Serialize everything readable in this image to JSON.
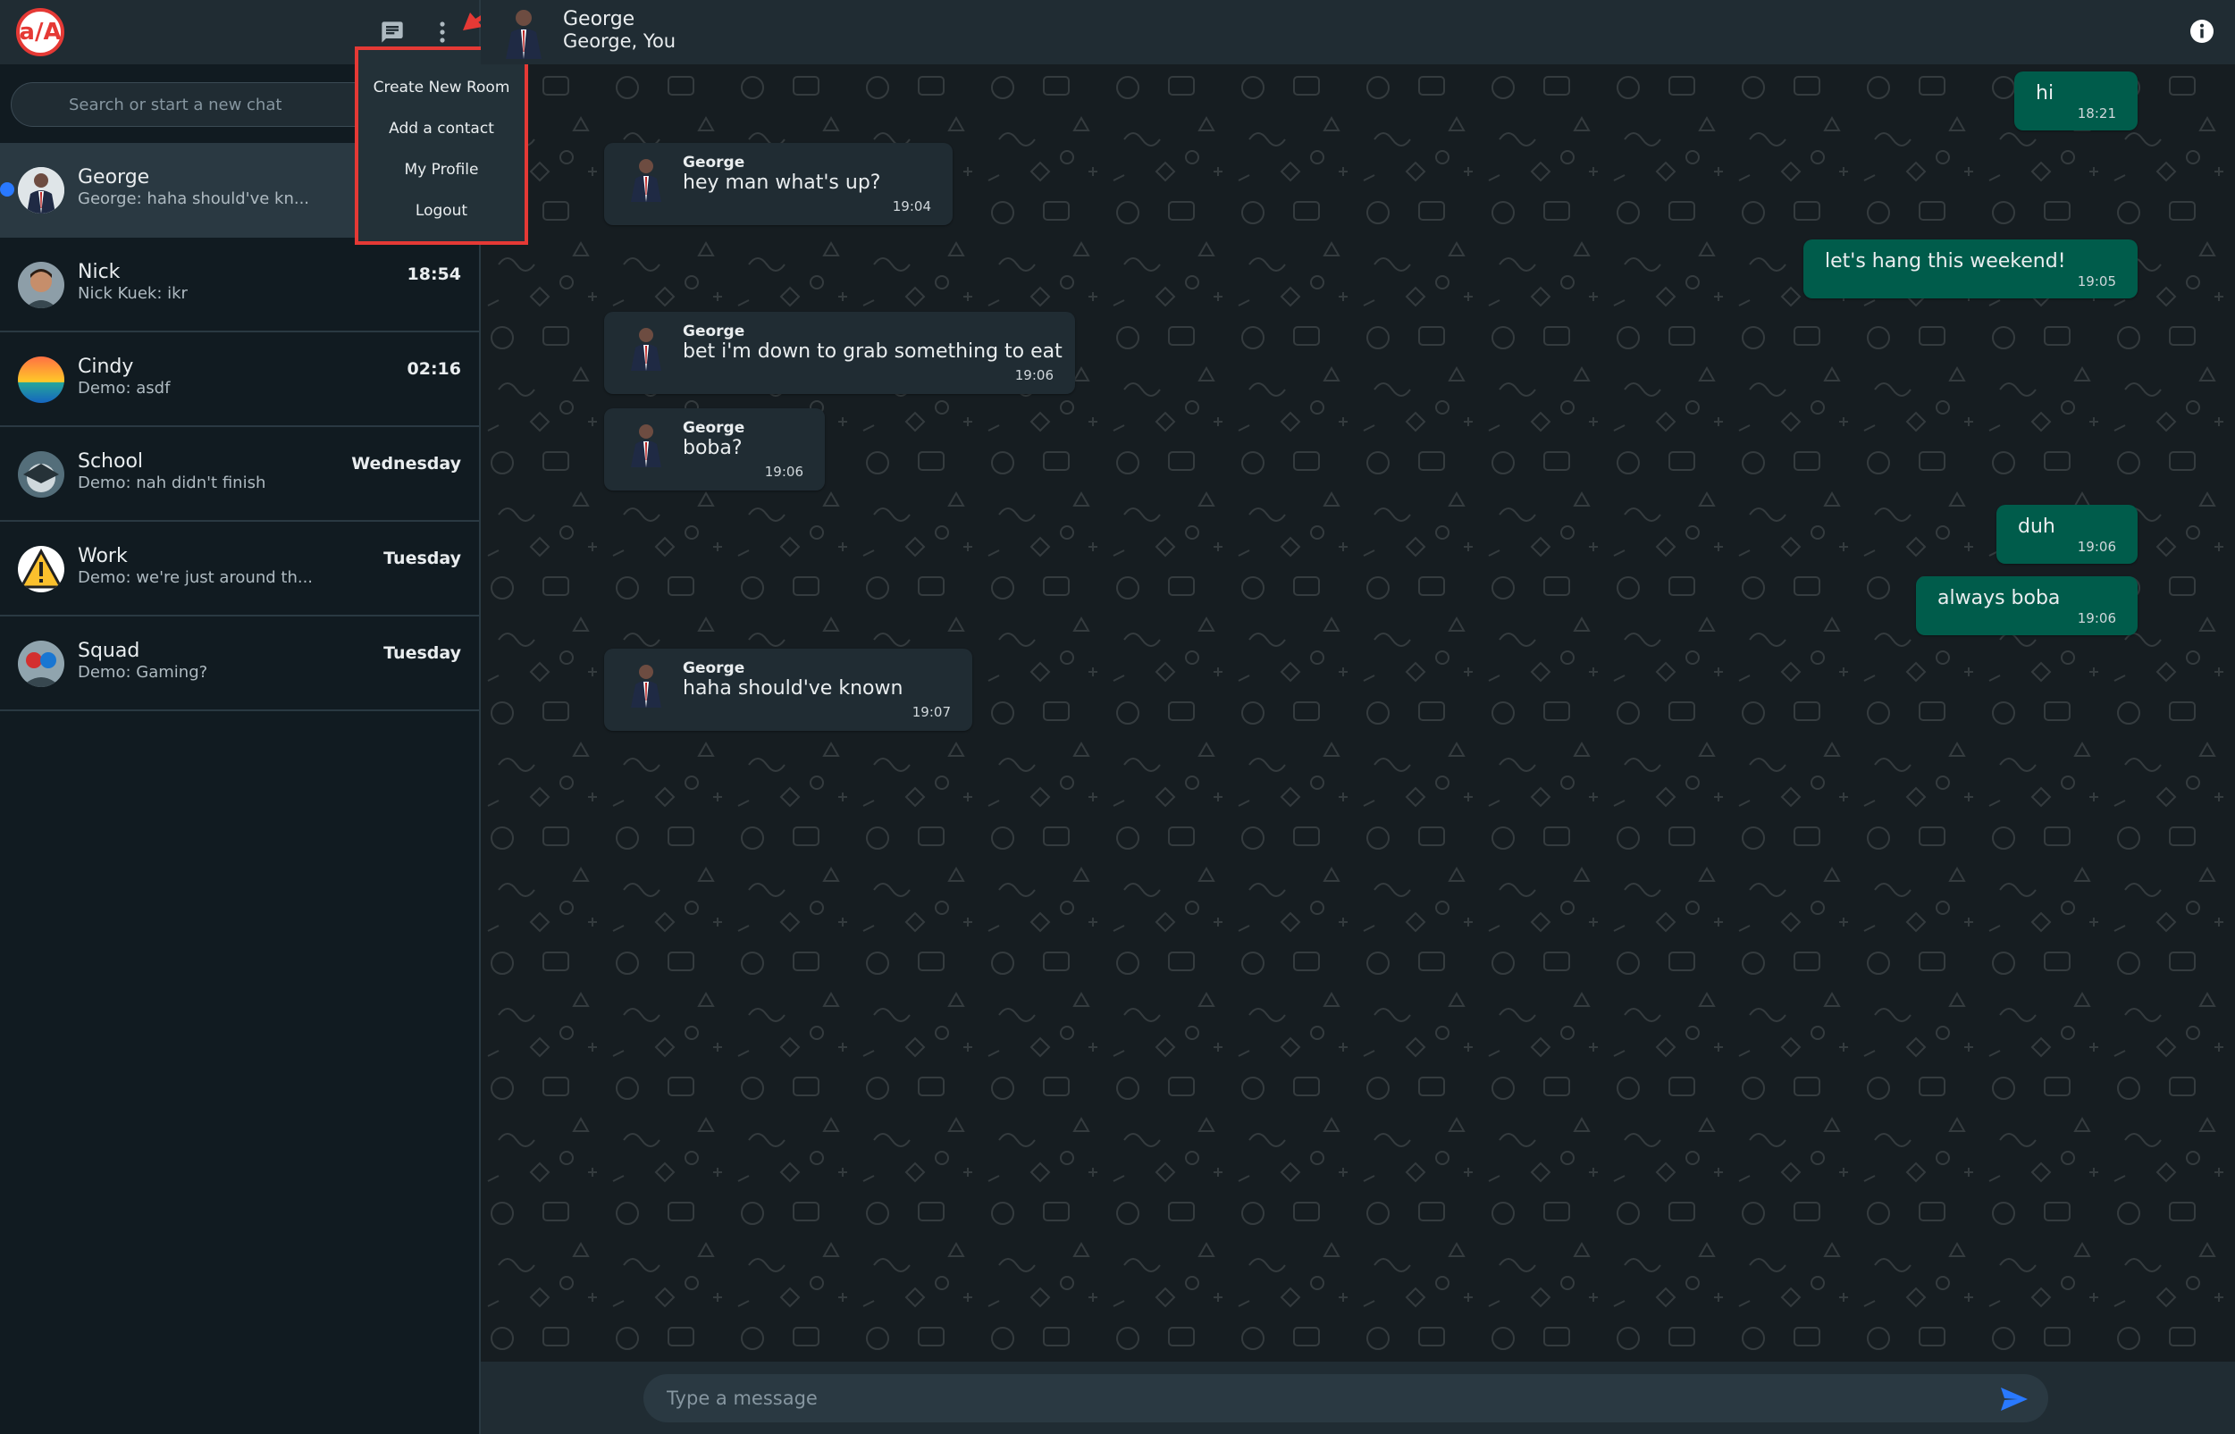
{
  "app": {
    "logo_text": "a/A"
  },
  "sidebar": {
    "search_placeholder": "Search or start a new chat",
    "menu": {
      "items": [
        "Create New Room",
        "Add a contact",
        "My Profile",
        "Logout"
      ]
    },
    "chats": [
      {
        "name": "George",
        "preview": "George: haha should've kn...",
        "time": "",
        "active": true,
        "unread": true
      },
      {
        "name": "Nick",
        "preview": "Nick Kuek: ikr",
        "time": "18:54"
      },
      {
        "name": "Cindy",
        "preview": "Demo: asdf",
        "time": "02:16"
      },
      {
        "name": "School",
        "preview": "Demo: nah didn't finish",
        "time": "Wednesday"
      },
      {
        "name": "Work",
        "preview": "Demo: we're just around th...",
        "time": "Tuesday"
      },
      {
        "name": "Squad",
        "preview": "Demo: Gaming?",
        "time": "Tuesday"
      }
    ]
  },
  "conversation": {
    "title": "George",
    "members": "George, You",
    "messages": [
      {
        "sender": "",
        "text": "hi",
        "time": "18:21",
        "outgoing": true
      },
      {
        "sender": "George",
        "text": "hey man what's up?",
        "time": "19:04",
        "outgoing": false
      },
      {
        "sender": "",
        "text": "let's hang this weekend!",
        "time": "19:05",
        "outgoing": true
      },
      {
        "sender": "George",
        "text": "bet i'm down to grab something to eat",
        "time": "19:06",
        "outgoing": false
      },
      {
        "sender": "George",
        "text": "boba?",
        "time": "19:06",
        "outgoing": false
      },
      {
        "sender": "",
        "text": "duh",
        "time": "19:06",
        "outgoing": true
      },
      {
        "sender": "",
        "text": "always boba",
        "time": "19:06",
        "outgoing": true
      },
      {
        "sender": "George",
        "text": "haha should've known",
        "time": "19:07",
        "outgoing": false
      }
    ]
  },
  "composer": {
    "placeholder": "Type a message"
  },
  "colors": {
    "accent": "#005c4b",
    "highlight_border": "#e53935",
    "unread_dot": "#2979ff"
  }
}
